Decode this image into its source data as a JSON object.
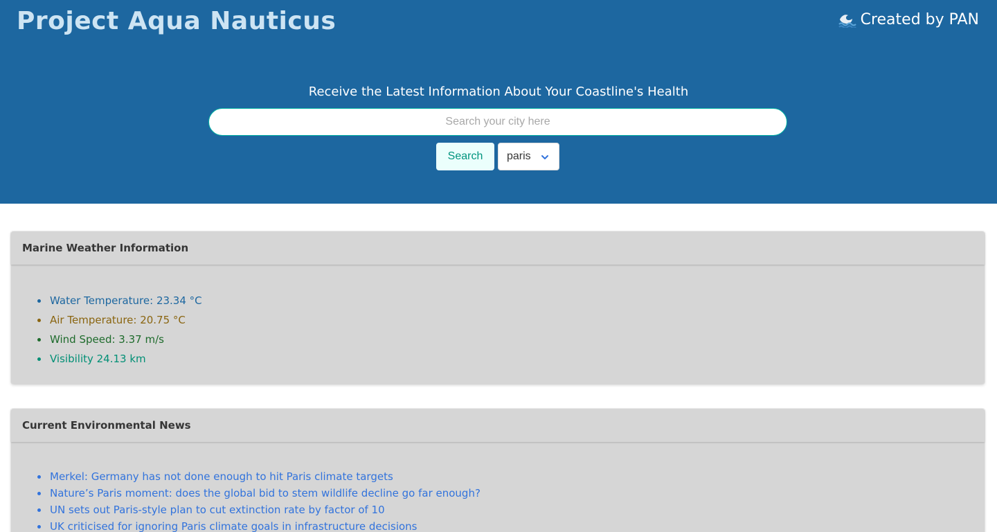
{
  "header": {
    "title": "Project Aqua Nauticus",
    "credit": "Created by PAN",
    "credit_icon": "wave-icon"
  },
  "search": {
    "tagline": "Receive the Latest Information About Your Coastline's Health",
    "placeholder": "Search your city here",
    "value": "",
    "button_label": "Search",
    "selected_city": "paris"
  },
  "weather": {
    "title": "Marine Weather Information",
    "items": [
      {
        "label": "Water Temperature: 23.34 °C",
        "color": "#1d67a0"
      },
      {
        "label": "Air Temperature: 20.75 °C",
        "color": "#8a6510"
      },
      {
        "label": "Wind Speed: 3.37 m/s",
        "color": "#1e6b2c"
      },
      {
        "label": "Visibility 24.13 km",
        "color": "#008f75"
      }
    ]
  },
  "news": {
    "title": "Current Environmental News",
    "items": [
      {
        "label": "Merkel: Germany has not done enough to hit Paris climate targets"
      },
      {
        "label": "Nature’s Paris moment: does the global bid to stem wildlife decline go far enough?"
      },
      {
        "label": "UN sets out Paris-style plan to cut extinction rate by factor of 10"
      },
      {
        "label": "UK criticised for ignoring Paris climate goals in infrastructure decisions"
      }
    ]
  },
  "colors": {
    "hero_bg": "#1d67a0",
    "accent": "#00b1a3",
    "card_bg": "#d6d6d6",
    "link": "#3273dc"
  }
}
